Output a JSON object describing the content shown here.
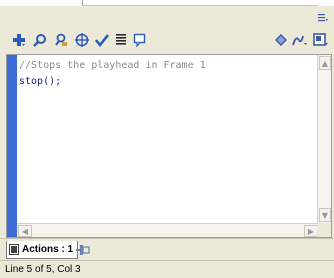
{
  "toolbar": {
    "left_icons": [
      "add-statement-icon",
      "find-icon",
      "find-replace-icon",
      "insert-target-path-icon",
      "check-syntax-icon",
      "auto-format-icon",
      "show-code-hint-icon"
    ],
    "right_icons": [
      "debug-options-icon",
      "reference-icon",
      "view-options-icon"
    ]
  },
  "editor": {
    "lines": [
      "//Stops the playhead in Frame 1",
      "stop();"
    ],
    "gutter_color": "#3d6bd6"
  },
  "tabs": [
    {
      "label": "Actions : 1",
      "active": true
    }
  ],
  "status": {
    "text": "Line 5 of 5, Col 3"
  },
  "colors": {
    "panel_bg": "#ece9d8",
    "comment": "#8a8a8a",
    "code": "#1c1c7c"
  }
}
